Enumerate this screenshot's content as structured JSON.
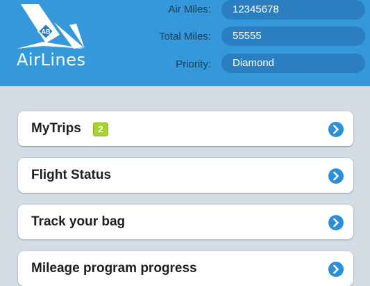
{
  "brand": {
    "name": "AirLines",
    "emblem": "AB"
  },
  "account": {
    "air_miles_label": "Air Miles:",
    "air_miles_value": "12345678",
    "total_miles_label": "Total Miles:",
    "total_miles_value": "55555",
    "priority_label": "Priority:",
    "priority_value": "Diamond"
  },
  "menu": {
    "items": [
      {
        "label": "MyTrips",
        "badge": "2",
        "icon": "chevron-right-icon"
      },
      {
        "label": "Flight Status",
        "icon": "chevron-right-icon"
      },
      {
        "label": "Track your bag",
        "icon": "chevron-right-icon"
      },
      {
        "label": "Mileage program progress",
        "icon": "chevron-right-icon"
      }
    ]
  },
  "colors": {
    "header_bg": "#3498db",
    "field_bg": "#2b7fc0",
    "page_bg": "#d4dde5",
    "badge_bg": "#a7d230",
    "chevron": "#2e8fd8"
  }
}
